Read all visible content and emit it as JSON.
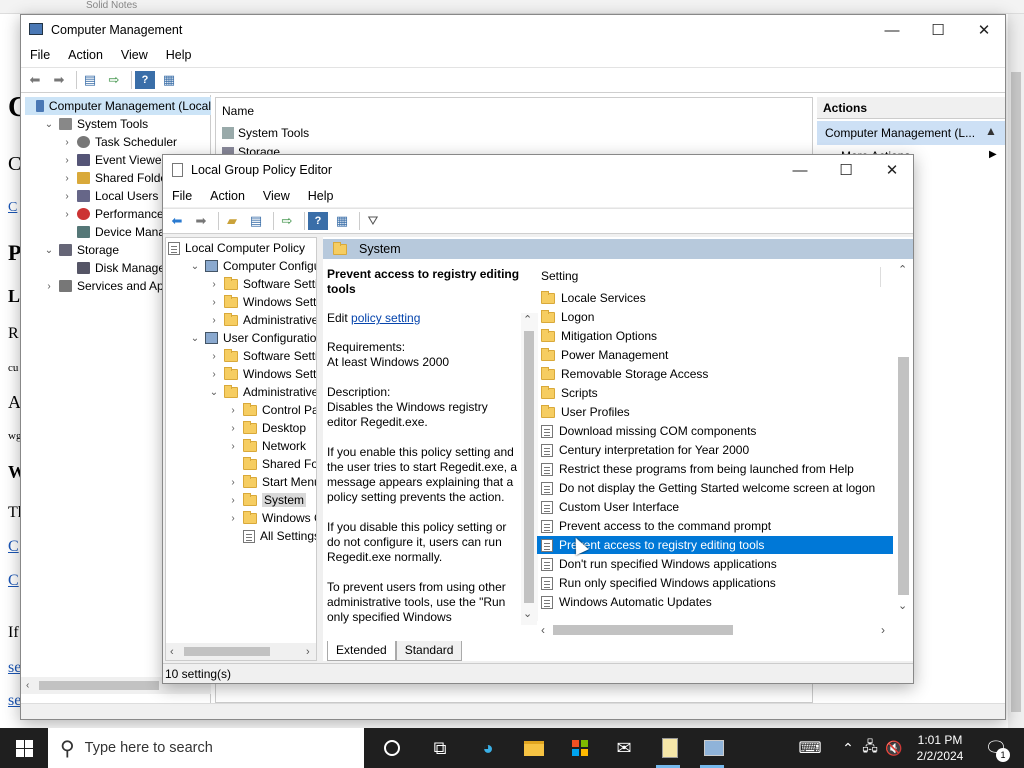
{
  "background": {
    "tab_text": "Solid Notes",
    "letters": [
      "C",
      "C",
      "C",
      "P",
      "L",
      "R",
      "cu",
      "A",
      "wg",
      "W",
      "Th",
      "C",
      "C",
      "If",
      "se",
      "se"
    ]
  },
  "cm": {
    "title": "Computer Management",
    "menu": [
      "File",
      "Action",
      "View",
      "Help"
    ],
    "tree": [
      {
        "label": "Computer Management (Local",
        "icon": "computer-icon"
      },
      {
        "label": "System Tools",
        "icon": "tools-icon"
      },
      {
        "label": "Task Scheduler",
        "icon": "clock-icon"
      },
      {
        "label": "Event Viewer",
        "icon": "event-viewer-icon"
      },
      {
        "label": "Shared Folders",
        "icon": "shared-folder-icon"
      },
      {
        "label": "Local Users an",
        "icon": "users-icon"
      },
      {
        "label": "Performance",
        "icon": "performance-icon"
      },
      {
        "label": "Device Manag",
        "icon": "device-manager-icon"
      },
      {
        "label": "Storage",
        "icon": "storage-icon"
      },
      {
        "label": "Disk Managem",
        "icon": "disk-icon"
      },
      {
        "label": "Services and Appli",
        "icon": "services-icon"
      }
    ],
    "name_header": "Name",
    "name_rows": [
      "System Tools",
      "Storage"
    ],
    "actions_header": "Actions",
    "actions_item": "Computer Management (L...",
    "more_actions": "More Actions"
  },
  "gp": {
    "title": "Local Group Policy Editor",
    "menu": [
      "File",
      "Action",
      "View",
      "Help"
    ],
    "tree": [
      {
        "label": "Local Computer Policy",
        "level": 0,
        "chev": ""
      },
      {
        "label": "Computer Configura",
        "level": 1,
        "chev": "⌄"
      },
      {
        "label": "Software Settings",
        "level": 2,
        "chev": "›"
      },
      {
        "label": "Windows Setting",
        "level": 2,
        "chev": "›"
      },
      {
        "label": "Administrative Te",
        "level": 2,
        "chev": "›"
      },
      {
        "label": "User Configuration",
        "level": 1,
        "chev": "⌄"
      },
      {
        "label": "Software Settings",
        "level": 2,
        "chev": "›"
      },
      {
        "label": "Windows Setting",
        "level": 2,
        "chev": "›"
      },
      {
        "label": "Administrative Te",
        "level": 2,
        "chev": "⌄"
      },
      {
        "label": "Control Panel",
        "level": 3,
        "chev": "›"
      },
      {
        "label": "Desktop",
        "level": 3,
        "chev": "›"
      },
      {
        "label": "Network",
        "level": 3,
        "chev": "›"
      },
      {
        "label": "Shared Folder",
        "level": 3,
        "chev": ""
      },
      {
        "label": "Start Menu ar",
        "level": 3,
        "chev": "›"
      },
      {
        "label": "System",
        "level": 3,
        "chev": "›"
      },
      {
        "label": "Windows Cor",
        "level": 3,
        "chev": "›"
      },
      {
        "label": "All Settings",
        "level": 3,
        "chev": ""
      }
    ],
    "header_folder": "System",
    "desc": {
      "title": "Prevent access to registry editing tools",
      "edit_prefix": "Edit",
      "edit_link": "policy setting",
      "requirements_label": "Requirements:",
      "requirements": "At least Windows 2000",
      "description_label": "Description:",
      "description": "Disables the Windows registry editor Regedit.exe.",
      "p1": "If you enable this policy setting and the user tries to start Regedit.exe, a message appears explaining that a policy setting prevents the action.",
      "p2": "If you disable this policy setting or do not configure it, users can run Regedit.exe normally.",
      "p3": "To prevent users from using other administrative tools, use the \"Run only specified Windows"
    },
    "setting_header": "Setting",
    "settings": [
      {
        "label": "Locale Services",
        "type": "folder"
      },
      {
        "label": "Logon",
        "type": "folder"
      },
      {
        "label": "Mitigation Options",
        "type": "folder"
      },
      {
        "label": "Power Management",
        "type": "folder"
      },
      {
        "label": "Removable Storage Access",
        "type": "folder"
      },
      {
        "label": "Scripts",
        "type": "folder"
      },
      {
        "label": "User Profiles",
        "type": "folder"
      },
      {
        "label": "Download missing COM components",
        "type": "policy"
      },
      {
        "label": "Century interpretation for Year 2000",
        "type": "policy"
      },
      {
        "label": "Restrict these programs from being launched from Help",
        "type": "policy"
      },
      {
        "label": "Do not display the Getting Started welcome screen at logon",
        "type": "policy"
      },
      {
        "label": "Custom User Interface",
        "type": "policy"
      },
      {
        "label": "Prevent access to the command prompt",
        "type": "policy"
      },
      {
        "label": "Prevent access to registry editing tools",
        "type": "policy",
        "selected": true
      },
      {
        "label": "Don't run specified Windows applications",
        "type": "policy"
      },
      {
        "label": "Run only specified Windows applications",
        "type": "policy"
      },
      {
        "label": "Windows Automatic Updates",
        "type": "policy"
      }
    ],
    "tabs": [
      "Extended",
      "Standard"
    ],
    "status": "10 setting(s)"
  },
  "taskbar": {
    "search_placeholder": "Type here to search",
    "time": "1:01 PM",
    "date": "2/2/2024",
    "notification_count": "1"
  },
  "colors": {
    "selection": "#0078d7",
    "header_bar": "#b7c9dc",
    "taskbar": "#1f1f1f"
  }
}
